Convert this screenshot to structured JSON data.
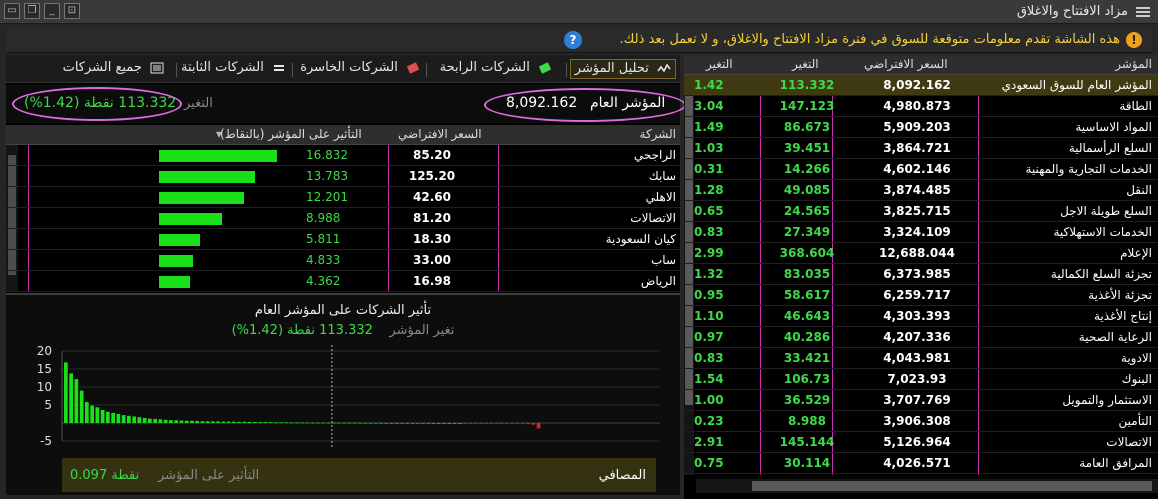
{
  "window": {
    "title": "مزاد الافتتاح والاغلاق",
    "controls": [
      "close-icon",
      "restore-icon",
      "minimize-icon",
      "pin-icon"
    ]
  },
  "notice": {
    "text": "هذه الشاشة تقدم معلومات متوقعة للسوق في فترة مزاد الافتتاح والاغلاق، و لا تعمل بعد ذلك.",
    "help": "?"
  },
  "toolbar": {
    "items": [
      {
        "label": "تحليل المؤشر",
        "icon": "chart-pulse-icon"
      },
      {
        "label": "الشركات الرابحة",
        "icon": "money-up-icon"
      },
      {
        "label": "الشركات الخاسرة",
        "icon": "money-down-icon"
      },
      {
        "label": "الشركات الثابتة",
        "icon": "equal-icon"
      },
      {
        "label": "جميع الشركات",
        "icon": "grid-list-icon"
      }
    ]
  },
  "summary": {
    "index_label": "المؤشر العام",
    "index_value": "8,092.162",
    "change_label": "التغير",
    "change_value": "113.332 نقطة (1.42%)"
  },
  "companies": {
    "headers": {
      "name": "الشركة",
      "price": "السعر الافتراضي",
      "impact": "التأثير على المؤشر (بالنقاط)"
    },
    "rows": [
      {
        "name": "الراجحي",
        "price": "85.20",
        "impact": "16.832"
      },
      {
        "name": "سابك",
        "price": "125.20",
        "impact": "13.783"
      },
      {
        "name": "الاهلي",
        "price": "42.60",
        "impact": "12.201"
      },
      {
        "name": "الاتصالات",
        "price": "81.20",
        "impact": "8.988"
      },
      {
        "name": "كيان السعودية",
        "price": "18.30",
        "impact": "5.811"
      },
      {
        "name": "ساب",
        "price": "33.00",
        "impact": "4.833"
      },
      {
        "name": "الرياض",
        "price": "16.98",
        "impact": "4.362"
      }
    ]
  },
  "impact_chart": {
    "title": "تأثير الشركات على المؤشر العام",
    "subtitle_label": "تغير المؤشر",
    "subtitle_value": "113.332 نقطة (1.42%)",
    "footer_name": "المصافي",
    "footer_label": "التأثير على المؤشر",
    "footer_value": "0.097 نقطة"
  },
  "chart_data": {
    "type": "bar",
    "yticks": [
      20,
      15,
      10,
      5,
      -5
    ],
    "ylim": [
      -5,
      20
    ],
    "values": [
      16.832,
      13.783,
      12.201,
      8.988,
      5.811,
      4.833,
      4.362,
      3.6,
      3.1,
      2.8,
      2.5,
      2.2,
      2.0,
      1.8,
      1.6,
      1.4,
      1.2,
      1.1,
      1.0,
      0.9,
      0.8,
      0.75,
      0.7,
      0.65,
      0.6,
      0.55,
      0.5,
      0.48,
      0.45,
      0.42,
      0.4,
      0.38,
      0.36,
      0.34,
      0.32,
      0.3,
      0.28,
      0.26,
      0.24,
      0.22,
      0.2,
      0.2,
      0.18,
      0.16,
      0.15,
      0.14,
      0.13,
      0.12,
      0.11,
      0.1,
      0.1,
      0.097,
      0.09,
      0.08,
      0.08,
      0.07,
      0.07,
      0.06,
      0.06,
      0.05,
      0.05,
      0.04,
      0.04,
      0.04,
      0.03,
      0.03,
      0.03,
      0.02,
      0.02,
      0.02,
      0.02,
      0.01,
      0.01,
      0.01,
      0.01,
      0.01,
      -0.01,
      -0.01,
      -0.02,
      -0.03,
      -0.04,
      -0.05,
      -0.06,
      -0.08,
      -0.1,
      -0.12,
      -0.15,
      -0.2,
      -0.3,
      -0.45,
      -1.5
    ]
  },
  "indices": {
    "headers": {
      "name": "المؤشر",
      "price": "السعر الافتراضي",
      "change": "التغير",
      "pct": "التغير"
    },
    "rows": [
      {
        "name": "المؤشر العام للسوق السعودي",
        "price": "8,092.162",
        "change": "113.332",
        "pct": "1.42"
      },
      {
        "name": "الطاقة",
        "price": "4,980.873",
        "change": "147.123",
        "pct": "3.04"
      },
      {
        "name": "المواد الاساسية",
        "price": "5,909.203",
        "change": "86.673",
        "pct": "1.49"
      },
      {
        "name": "السلع الرأسمالية",
        "price": "3,864.721",
        "change": "39.451",
        "pct": "1.03"
      },
      {
        "name": "الخدمات التجارية والمهنية",
        "price": "4,602.146",
        "change": "14.266",
        "pct": "0.31"
      },
      {
        "name": "النقل",
        "price": "3,874.485",
        "change": "49.085",
        "pct": "1.28"
      },
      {
        "name": "السلع طويلة الاجل",
        "price": "3,825.715",
        "change": "24.565",
        "pct": "0.65"
      },
      {
        "name": "الخدمات الاستهلاكية",
        "price": "3,324.109",
        "change": "27.349",
        "pct": "0.83"
      },
      {
        "name": "الإعلام",
        "price": "12,688.044",
        "change": "368.604",
        "pct": "2.99"
      },
      {
        "name": "تجزئة السلع الكمالية",
        "price": "6,373.985",
        "change": "83.035",
        "pct": "1.32"
      },
      {
        "name": "تجزئة الأغذية",
        "price": "6,259.717",
        "change": "58.617",
        "pct": "0.95"
      },
      {
        "name": "إنتاج الأغذية",
        "price": "4,303.393",
        "change": "46.643",
        "pct": "1.10"
      },
      {
        "name": "الرعاية الصحية",
        "price": "4,207.336",
        "change": "40.286",
        "pct": "0.97"
      },
      {
        "name": "الادوية",
        "price": "4,043.981",
        "change": "33.421",
        "pct": "0.83"
      },
      {
        "name": "البنوك",
        "price": "7,023.93",
        "change": "106.73",
        "pct": "1.54"
      },
      {
        "name": "الاستثمار والتمويل",
        "price": "3,707.769",
        "change": "36.529",
        "pct": "1.00"
      },
      {
        "name": "التأمين",
        "price": "3,906.308",
        "change": "8.988",
        "pct": "0.23"
      },
      {
        "name": "الاتصالات",
        "price": "5,126.964",
        "change": "145.144",
        "pct": "2.91"
      },
      {
        "name": "المرافق العامة",
        "price": "4,026.571",
        "change": "30.114",
        "pct": "0.75"
      }
    ]
  },
  "colors": {
    "positive": "#19e019",
    "negative": "#e02020",
    "accent": "#e06bdc",
    "notice_text": "#f5d23a"
  }
}
